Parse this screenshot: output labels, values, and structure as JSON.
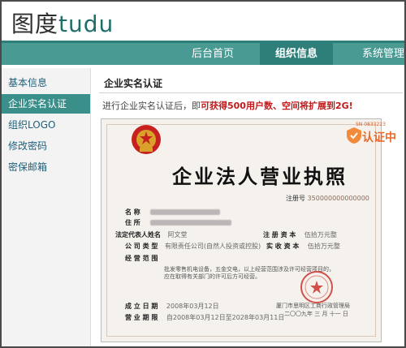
{
  "header": {
    "logo_text_a": "图度",
    "logo_text_b": "tudu"
  },
  "nav": {
    "home": "后台首页",
    "org": "组织信息",
    "sys": "系统管理"
  },
  "sidebar": {
    "items": [
      {
        "label": "基本信息"
      },
      {
        "label": "企业实名认证"
      },
      {
        "label": "组织LOGO"
      },
      {
        "label": "修改密码"
      },
      {
        "label": "密保邮箱"
      }
    ]
  },
  "main": {
    "title": "企业实名认证",
    "notice_pre": "进行企业实名认证后，即",
    "notice_hl": "可获得500用户数、空间将扩展到2G!"
  },
  "license": {
    "title": "企业法人营业执照",
    "reg_label": "注册号",
    "reg_value": "350000000000000",
    "name_label": "名         称",
    "addr_label": "住         所",
    "rep_label": "法定代表人姓名",
    "rep_value": "阿文堂",
    "capital_label": "注  册  资  本",
    "capital_value": "伍拾万元整",
    "type_label": "公  司  类  型",
    "type_value": "有限责任公司(自然人投资或控股)",
    "paid_label": "实  收  资  本",
    "paid_value": "伍拾万元整",
    "scope_label": "经  营  范  围",
    "scope_note": "批发零售机电设备，五金交电，以上经营范围涉及许可经营项目的，应在取得有关部门的许可后方可经营。",
    "est_label": "成  立  日  期",
    "est_value": "2008年03月12日",
    "term_label": "营  业  期  限",
    "term_value": "自2008年03月12日至2028年03月11日",
    "authority": "厦门市思明区工商行政管理局",
    "date_cn": "二〇〇九年  三  月  十一  日"
  },
  "badge": {
    "code": "SN 0833223",
    "text": "认证中"
  }
}
